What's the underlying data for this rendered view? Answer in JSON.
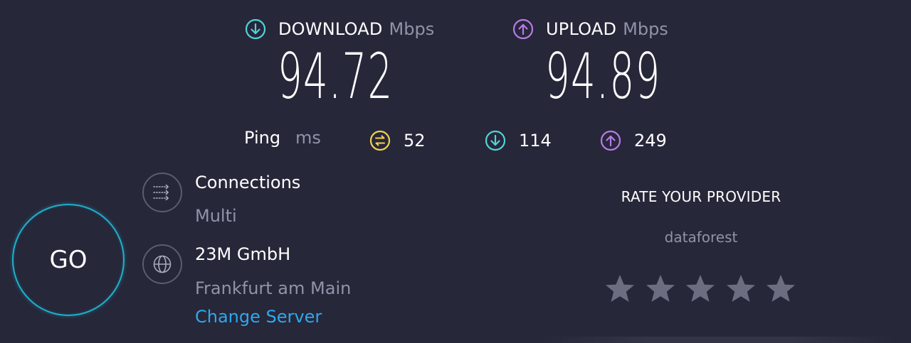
{
  "download": {
    "label": "DOWNLOAD",
    "unit": "Mbps",
    "value": "94.72",
    "icon": "download-arrow-icon",
    "color": "#52d2d8"
  },
  "upload": {
    "label": "UPLOAD",
    "unit": "Mbps",
    "value": "94.89",
    "icon": "upload-arrow-icon",
    "color": "#b77be6"
  },
  "ping": {
    "label": "Ping",
    "unit": "ms",
    "idle": {
      "value": "52",
      "icon": "idle-latency-icon",
      "color": "#f2d14e"
    },
    "download": {
      "value": "114",
      "icon": "download-arrow-icon",
      "color": "#52d2d8"
    },
    "upload": {
      "value": "249",
      "icon": "upload-arrow-icon",
      "color": "#b77be6"
    }
  },
  "go_button": {
    "label": "GO",
    "color": "#1fb0cc"
  },
  "connections": {
    "title": "Connections",
    "value": "Multi",
    "icon": "connections-icon"
  },
  "server": {
    "isp": "23M GmbH",
    "location": "Frankfurt am Main",
    "change_label": "Change Server",
    "icon": "globe-icon",
    "link_color": "#2ea8ef"
  },
  "rating": {
    "title": "RATE YOUR PROVIDER",
    "provider": "dataforest",
    "stars_total": 5,
    "stars_selected": 0,
    "star_color": "#6b6d80"
  }
}
